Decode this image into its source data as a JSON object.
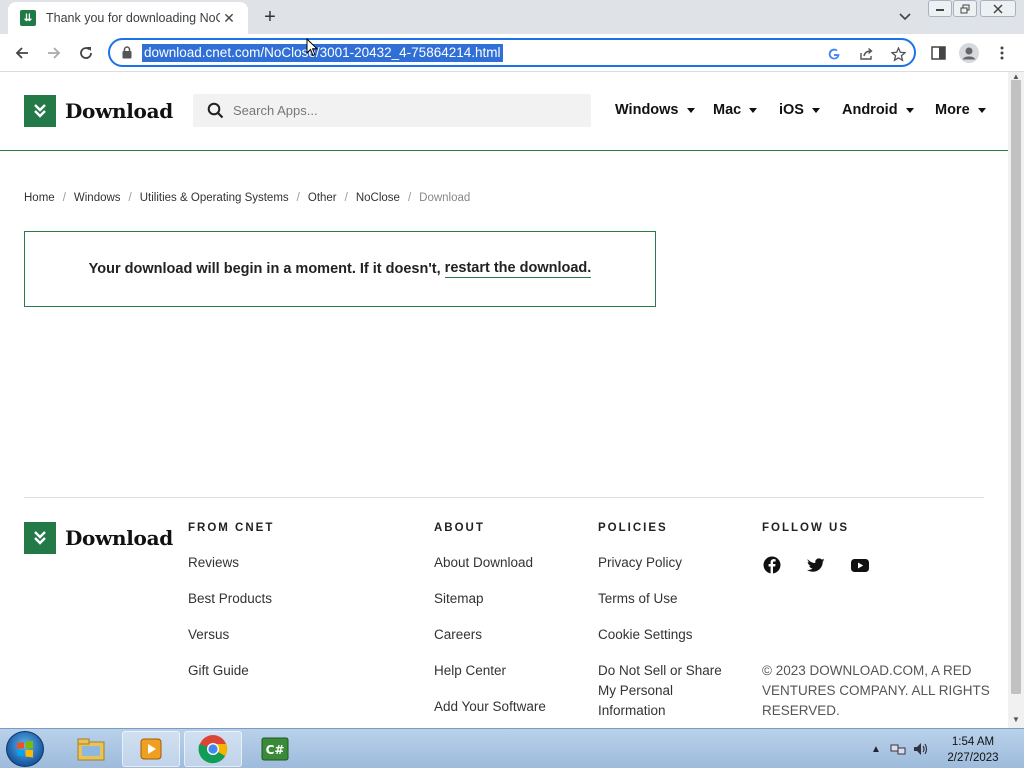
{
  "browser": {
    "tab_title": "Thank you for downloading NoClose",
    "tab_close": "✕",
    "new_tab": "+",
    "url": "download.cnet.com/NoClose/3001-20432_4-75864214.html"
  },
  "site": {
    "logo_text": "Download",
    "search_placeholder": "Search Apps...",
    "nav": [
      "Windows",
      "Mac",
      "iOS",
      "Android",
      "More"
    ]
  },
  "breadcrumb": [
    "Home",
    "Windows",
    "Utilities & Operating Systems",
    "Other",
    "NoClose",
    "Download"
  ],
  "breadcrumb_separator": "/",
  "notice": {
    "text": "Your download will begin in a moment. If it doesn't,",
    "link": "restart the download."
  },
  "footer": {
    "logo_text": "Download",
    "from_cnet": {
      "heading": "FROM CNET",
      "links": [
        "Reviews",
        "Best Products",
        "Versus",
        "Gift Guide"
      ]
    },
    "about": {
      "heading": "ABOUT",
      "links": [
        "About Download",
        "Sitemap",
        "Careers",
        "Help Center",
        "Add Your Software"
      ]
    },
    "policies": {
      "heading": "POLICIES",
      "links": [
        "Privacy Policy",
        "Terms of Use",
        "Cookie Settings",
        "Do Not Sell or Share My Personal Information"
      ]
    },
    "follow": {
      "heading": "FOLLOW US",
      "icons": [
        "facebook-icon",
        "twitter-icon",
        "youtube-icon"
      ]
    },
    "copyright": "© 2023 DOWNLOAD.COM, A RED VENTURES COMPANY. ALL RIGHTS RESERVED."
  },
  "taskbar": {
    "time": "1:54 AM",
    "date": "2/27/2023",
    "apps": [
      "windows-explorer-icon",
      "media-player-icon",
      "chrome-icon",
      "csharp-app-icon"
    ]
  },
  "colors": {
    "brand_green": "#237a48",
    "omnibox_focus": "#1a73e8",
    "url_selection": "#2f6fd6"
  }
}
